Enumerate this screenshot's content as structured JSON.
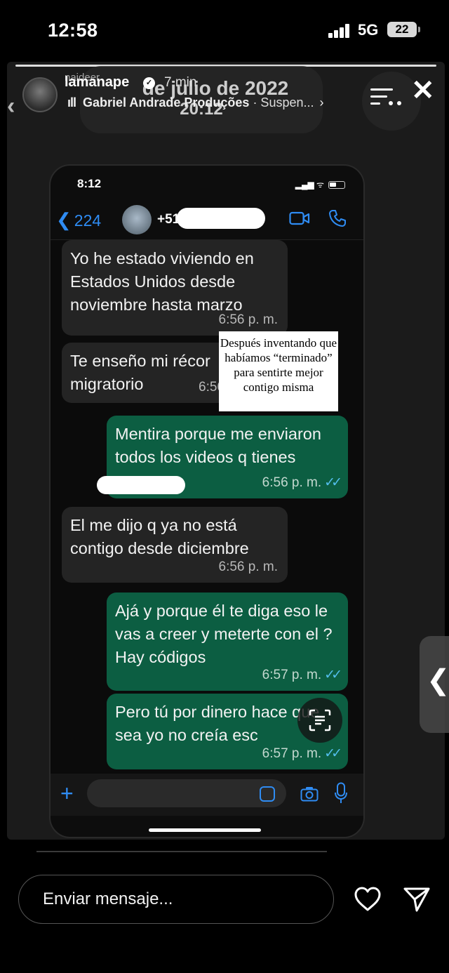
{
  "status_bar": {
    "time": "12:58",
    "network": "5G",
    "battery": "22"
  },
  "story": {
    "username": "lamanape",
    "time_ago": "7 min",
    "second_handle": "naideer",
    "music_artist": "Gabriel Andrade Produções",
    "music_track": "· Suspen...",
    "date_line": "de julio de 2022",
    "date_time": "20:12",
    "icons": [
      "verified-badge",
      "music-bars-icon",
      "options-icon",
      "close-icon"
    ]
  },
  "chat": {
    "phone_time": "8:12",
    "back_count": "224",
    "contact_name": "+51",
    "messages": [
      {
        "dir": "in",
        "text": "Yo he estado viviendo en Estados Unidos desde noviembre hasta marzo",
        "time": "6:56 p. m."
      },
      {
        "dir": "in",
        "text": "Te enseño mi récor migratorio",
        "time": "6:56"
      },
      {
        "dir": "out",
        "text": "Mentira porque me enviaron todos los videos q tienes",
        "time": "6:56 p. m."
      },
      {
        "dir": "in",
        "text": "El me dijo q ya no está contigo desde diciembre",
        "time": "6:56 p. m."
      },
      {
        "dir": "out",
        "text": "Ajá y porque él te diga eso le vas a creer y meterte con el ? Hay códigos",
        "time": "6:57 p. m."
      },
      {
        "dir": "out",
        "text": "Pero tú por dinero hace que sea yo no creía esc",
        "time": "6:57 p. m."
      }
    ],
    "overlay_note": "Después inventando que habíamos “terminado” para sentirte mejor contigo misma"
  },
  "reply": {
    "placeholder": "Enviar mensaje..."
  },
  "colors": {
    "outgoing": "#0c5e42",
    "incoming": "#242424",
    "ios_blue": "#2f8cf3",
    "read_ticks": "#53bdeb"
  }
}
